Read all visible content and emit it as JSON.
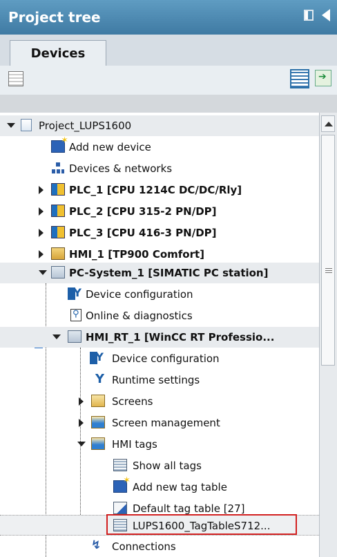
{
  "panel": {
    "title": "Project tree"
  },
  "tabs": {
    "devices_label": "Devices"
  },
  "tree": {
    "project": "Project_LUPS1600",
    "add_new_device": "Add new device",
    "devices_networks": "Devices & networks",
    "plc1": "PLC_1 [CPU 1214C DC/DC/Rly]",
    "plc2": "PLC_2 [CPU 315-2 PN/DP]",
    "plc3": "PLC_3 [CPU 416-3 PN/DP]",
    "hmi1": "HMI_1 [TP900 Comfort]",
    "pc_system": "PC-System_1 [SIMATIC PC station]",
    "pc_device_config": "Device configuration",
    "pc_online_diag": "Online & diagnostics",
    "hmi_rt": "HMI_RT_1 [WinCC RT Professio...",
    "rt_device_config": "Device configuration",
    "runtime_settings": "Runtime settings",
    "screens": "Screens",
    "screen_management": "Screen management",
    "hmi_tags": "HMI tags",
    "show_all_tags": "Show all tags",
    "add_new_tag_table": "Add new tag table",
    "default_tag_table": "Default tag table [27]",
    "lups_tag_table": "LUPS1600_TagTableS712...",
    "connections": "Connections"
  },
  "colors": {
    "title_bar": "#4f8cb6",
    "highlight_border": "#d21f1f"
  },
  "icons": {
    "project": "project-icon",
    "folder": "folder-icon",
    "plc": "plc-icon",
    "hmi": "hmi-icon",
    "pc": "pc-station-icon",
    "tag_table": "tag-table-icon"
  }
}
